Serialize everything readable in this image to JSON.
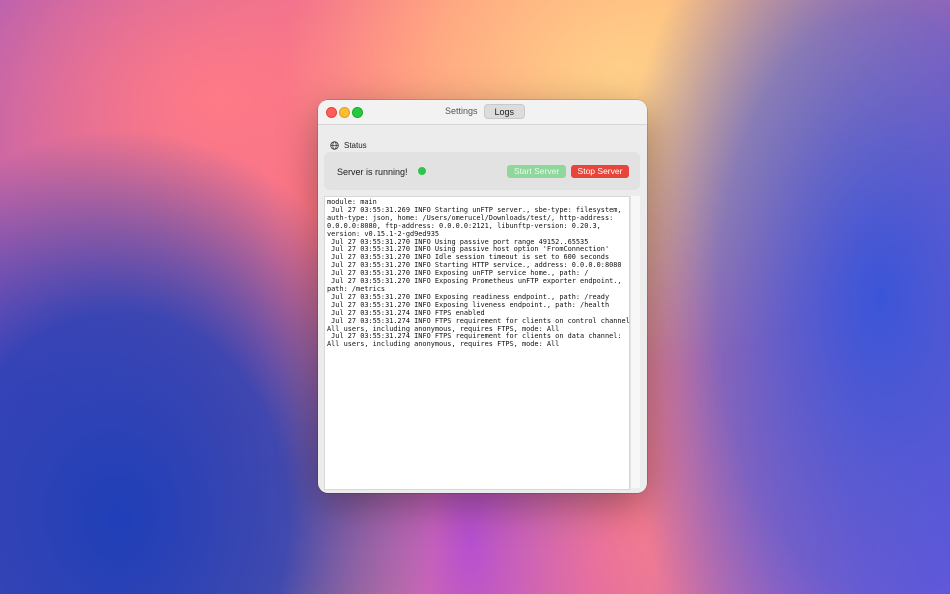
{
  "window": {
    "tabs": [
      {
        "label": "Settings",
        "active": false
      },
      {
        "label": "Logs",
        "active": true
      }
    ]
  },
  "status": {
    "section_title": "Status",
    "icon": "globe-icon",
    "running_text": "Server is running!",
    "indicator_color": "#2fc54a",
    "start_button": "Start Server",
    "stop_button": "Stop Server"
  },
  "logs": {
    "lines": [
      "module: main",
      " Jul 27 03:55:31.269 INFO Starting unFTP server., sbe-type: filesystem,",
      "auth-type: json, home: /Users/omerucel/Downloads/test/, http-address:",
      "0.0.0.0:8080, ftp-address: 0.0.0.0:2121, libunftp-version: 0.20.3,",
      "version: v0.15.1-2-gd9ed935",
      " Jul 27 03:55:31.270 INFO Using passive port range 49152..65535",
      " Jul 27 03:55:31.270 INFO Using passive host option 'FromConnection'",
      " Jul 27 03:55:31.270 INFO Idle session timeout is set to 600 seconds",
      " Jul 27 03:55:31.270 INFO Starting HTTP service., address: 0.0.0.0:8080",
      " Jul 27 03:55:31.270 INFO Exposing unFTP service home., path: /",
      " Jul 27 03:55:31.270 INFO Exposing Prometheus unFTP exporter endpoint.,",
      "path: /metrics",
      " Jul 27 03:55:31.270 INFO Exposing readiness endpoint., path: /ready",
      " Jul 27 03:55:31.270 INFO Exposing liveness endpoint., path: /health",
      " Jul 27 03:55:31.274 INFO FTPS enabled",
      " Jul 27 03:55:31.274 INFO FTPS requirement for clients on control channel:",
      "All users, including anonymous, requires FTPS, mode: All",
      " Jul 27 03:55:31.274 INFO FTPS requirement for clients on data channel:",
      "All users, including anonymous, requires FTPS, mode: All"
    ]
  }
}
